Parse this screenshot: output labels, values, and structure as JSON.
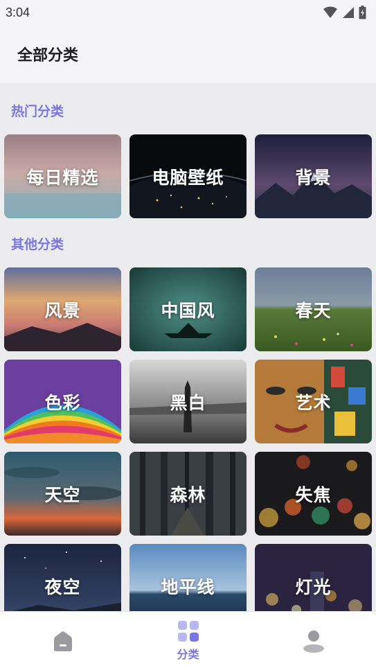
{
  "status_bar": {
    "time": "3:04",
    "icons": [
      "wifi-icon",
      "signal-icon",
      "battery-icon"
    ]
  },
  "header": {
    "title": "全部分类"
  },
  "sections": {
    "hot": {
      "title": "热门分类",
      "items": [
        {
          "label": "每日精选",
          "icon": "category-daily-picks"
        },
        {
          "label": "电脑壁纸",
          "icon": "category-desktop-wallpaper"
        },
        {
          "label": "背景",
          "icon": "category-background"
        }
      ]
    },
    "other": {
      "title": "其他分类",
      "items": [
        {
          "label": "风景",
          "icon": "category-scenery"
        },
        {
          "label": "中国风",
          "icon": "category-chinese-style"
        },
        {
          "label": "春天",
          "icon": "category-spring"
        },
        {
          "label": "色彩",
          "icon": "category-colors"
        },
        {
          "label": "黑白",
          "icon": "category-black-white"
        },
        {
          "label": "艺术",
          "icon": "category-art"
        },
        {
          "label": "天空",
          "icon": "category-sky"
        },
        {
          "label": "森林",
          "icon": "category-forest"
        },
        {
          "label": "失焦",
          "icon": "category-bokeh"
        },
        {
          "label": "夜空",
          "icon": "category-night-sky"
        },
        {
          "label": "地平线",
          "icon": "category-horizon"
        },
        {
          "label": "灯光",
          "icon": "category-lights"
        }
      ]
    }
  },
  "bottom_nav": {
    "items": [
      {
        "name": "home",
        "label": "",
        "icon": "home-icon",
        "active": false
      },
      {
        "name": "categories",
        "label": "分类",
        "icon": "grid-icon",
        "active": true
      },
      {
        "name": "profile",
        "label": "",
        "icon": "user-icon",
        "active": false
      }
    ]
  },
  "colors": {
    "accent": "#7a76e4",
    "background": "#ececee",
    "header_bg": "#f5f5f7",
    "inactive_icon": "#9a9aa0"
  }
}
